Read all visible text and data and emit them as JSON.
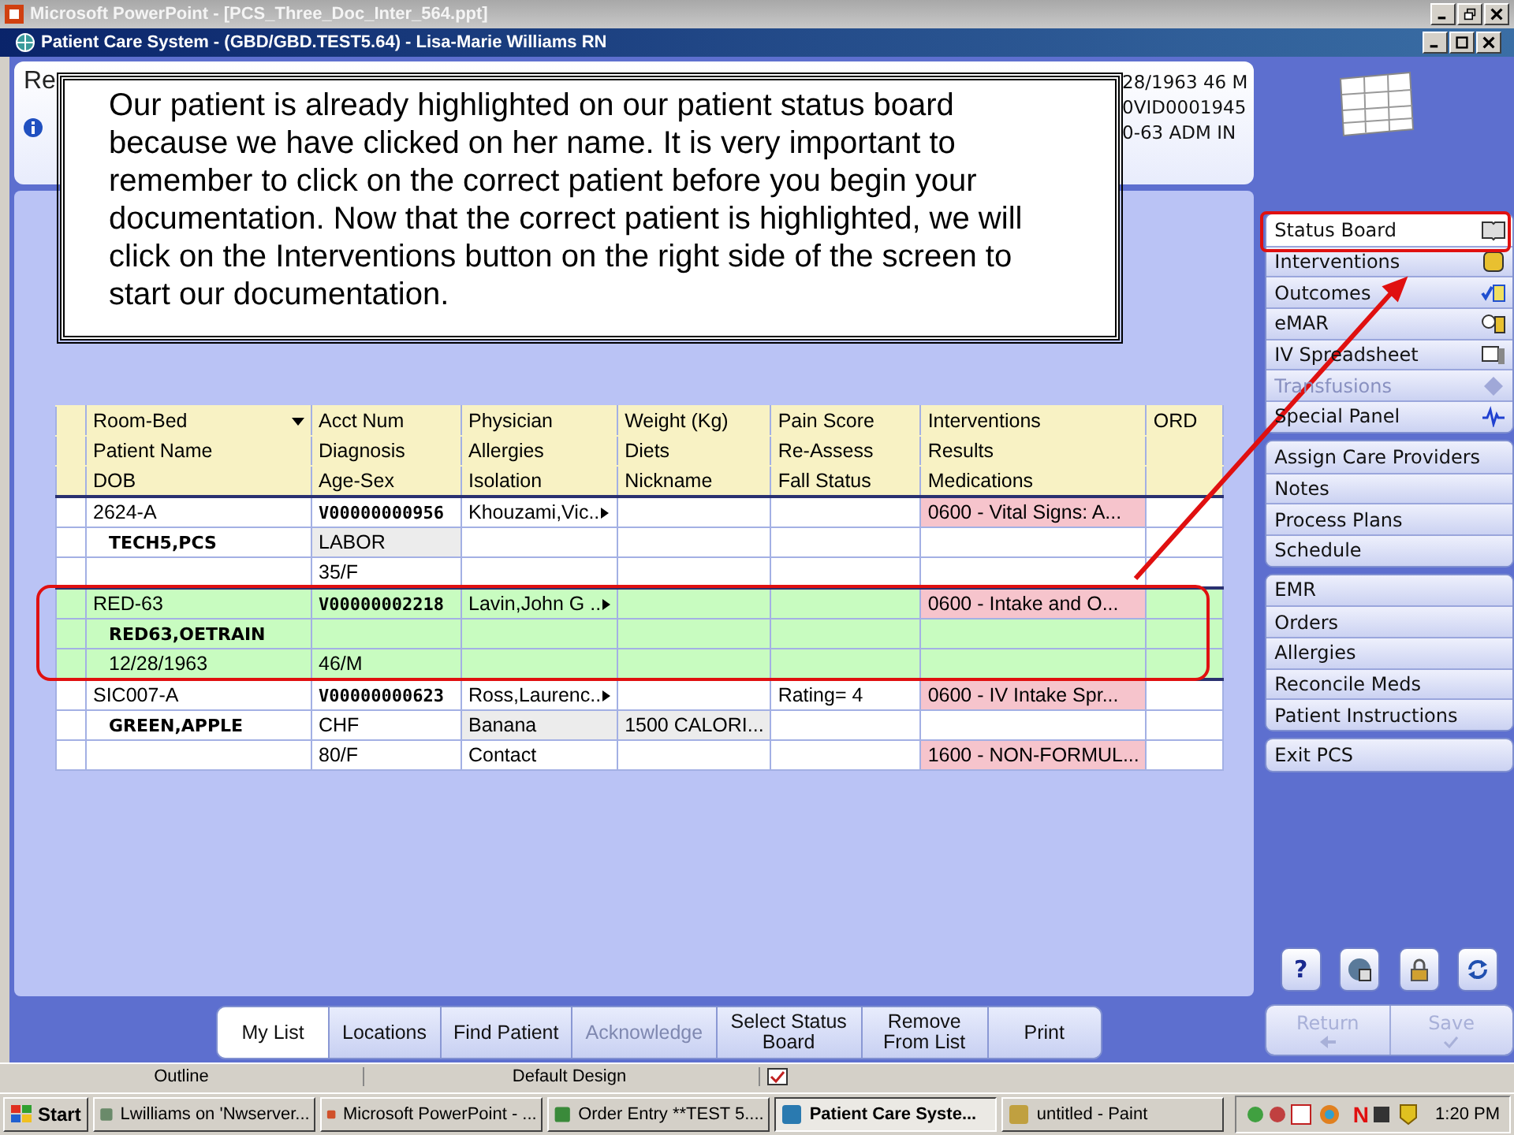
{
  "app_window": {
    "title": "Microsoft PowerPoint - [PCS_Three_Doc_Inter_564.ppt]"
  },
  "pcs_window": {
    "title": "Patient Care System - (GBD/GBD.TEST5.64) - Lisa-Marie Williams RN"
  },
  "patient_header": {
    "name_fragment": "Re",
    "right_lines": [
      "28/1963 46 M",
      "0VID0001945",
      "0-63  ADM IN"
    ]
  },
  "callout": {
    "text": "Our patient is already highlighted on our patient status board because we have clicked on her name. It is very important to remember to click on the correct patient before you begin your documentation. Now that the correct patient is highlighted, we will click on the Interventions button on the right side of the screen to start our documentation."
  },
  "table": {
    "header_rows": [
      [
        {
          "kind": "label",
          "text": "Room-Bed"
        },
        {
          "kind": "label",
          "text": "Acct Num"
        },
        {
          "kind": "label",
          "text": "Physician"
        },
        {
          "kind": "label",
          "text": "Weight (Kg)"
        },
        {
          "kind": "label",
          "text": "Pain Score"
        },
        {
          "kind": "label",
          "text": "Interventions"
        },
        {
          "kind": "label",
          "text": "ORD"
        }
      ],
      [
        {
          "kind": "label",
          "text": "Patient Name"
        },
        {
          "kind": "label",
          "text": "Diagnosis"
        },
        {
          "kind": "label",
          "text": "Allergies"
        },
        {
          "kind": "label",
          "text": "Diets"
        },
        {
          "kind": "label",
          "text": "Re-Assess"
        },
        {
          "kind": "label",
          "text": "Results"
        },
        {
          "kind": "empty"
        }
      ],
      [
        {
          "kind": "label",
          "text": "DOB"
        },
        {
          "kind": "label",
          "text": "Age-Sex"
        },
        {
          "kind": "label",
          "text": "Isolation"
        },
        {
          "kind": "label",
          "text": "Nickname"
        },
        {
          "kind": "label",
          "text": "Fall Status"
        },
        {
          "kind": "label",
          "text": "Medications"
        },
        {
          "kind": "empty"
        }
      ]
    ],
    "patients": [
      {
        "selected": false,
        "lines": [
          [
            {
              "kind": "text",
              "text": "2624-A"
            },
            {
              "kind": "code",
              "text": "V00000000956"
            },
            {
              "kind": "link",
              "text": "Khouzami,Vic.."
            },
            {
              "kind": "empty"
            },
            {
              "kind": "empty"
            },
            {
              "kind": "alert",
              "text": "0600 - Vital Signs: A..."
            },
            {
              "kind": "empty"
            }
          ],
          [
            {
              "kind": "name",
              "text": "TECH5,PCS"
            },
            {
              "kind": "shaded",
              "text": "LABOR"
            },
            {
              "kind": "empty"
            },
            {
              "kind": "empty"
            },
            {
              "kind": "empty"
            },
            {
              "kind": "empty"
            },
            {
              "kind": "empty"
            }
          ],
          [
            {
              "kind": "empty"
            },
            {
              "kind": "text",
              "text": "35/F"
            },
            {
              "kind": "empty"
            },
            {
              "kind": "empty"
            },
            {
              "kind": "empty"
            },
            {
              "kind": "empty"
            },
            {
              "kind": "empty"
            }
          ]
        ]
      },
      {
        "selected": true,
        "lines": [
          [
            {
              "kind": "text",
              "text": "RED-63"
            },
            {
              "kind": "code",
              "text": "V00000002218"
            },
            {
              "kind": "link",
              "text": "Lavin,John G .."
            },
            {
              "kind": "empty"
            },
            {
              "kind": "empty"
            },
            {
              "kind": "alert",
              "text": "0600 - Intake and O..."
            },
            {
              "kind": "empty"
            }
          ],
          [
            {
              "kind": "name",
              "text": "RED63,OETRAIN"
            },
            {
              "kind": "empty"
            },
            {
              "kind": "empty"
            },
            {
              "kind": "empty"
            },
            {
              "kind": "empty"
            },
            {
              "kind": "empty"
            },
            {
              "kind": "empty"
            }
          ],
          [
            {
              "kind": "indent",
              "text": "12/28/1963"
            },
            {
              "kind": "text",
              "text": "46/M"
            },
            {
              "kind": "empty"
            },
            {
              "kind": "empty"
            },
            {
              "kind": "empty"
            },
            {
              "kind": "empty"
            },
            {
              "kind": "empty"
            }
          ]
        ]
      },
      {
        "selected": false,
        "lines": [
          [
            {
              "kind": "text",
              "text": "SIC007-A"
            },
            {
              "kind": "code",
              "text": "V00000000623"
            },
            {
              "kind": "link",
              "text": "Ross,Laurenc.."
            },
            {
              "kind": "empty"
            },
            {
              "kind": "text",
              "text": "Rating= 4"
            },
            {
              "kind": "alert",
              "text": "0600 - IV Intake Spr..."
            },
            {
              "kind": "empty"
            }
          ],
          [
            {
              "kind": "name",
              "text": "GREEN,APPLE"
            },
            {
              "kind": "text",
              "text": "CHF"
            },
            {
              "kind": "shaded",
              "text": "Banana"
            },
            {
              "kind": "shaded",
              "text": "1500 CALORI..."
            },
            {
              "kind": "empty"
            },
            {
              "kind": "empty"
            },
            {
              "kind": "empty"
            }
          ],
          [
            {
              "kind": "empty"
            },
            {
              "kind": "text",
              "text": "80/F"
            },
            {
              "kind": "text",
              "text": "Contact"
            },
            {
              "kind": "empty"
            },
            {
              "kind": "empty"
            },
            {
              "kind": "alert",
              "text": "1600 - NON-FORMUL..."
            },
            {
              "kind": "empty"
            }
          ]
        ]
      }
    ]
  },
  "sidebar": {
    "groups": [
      [
        {
          "label": "Status Board",
          "selected": true,
          "disabled": false
        },
        {
          "label": "Interventions",
          "selected": false,
          "disabled": false
        },
        {
          "label": "Outcomes",
          "selected": false,
          "disabled": false
        },
        {
          "label": "eMAR",
          "selected": false,
          "disabled": false
        },
        {
          "label": "IV Spreadsheet",
          "selected": false,
          "disabled": false
        },
        {
          "label": "Transfusions",
          "selected": false,
          "disabled": true
        },
        {
          "label": "Special Panel",
          "selected": false,
          "disabled": false
        }
      ],
      [
        {
          "label": "Assign Care Providers",
          "selected": false,
          "disabled": false
        },
        {
          "label": "Notes",
          "selected": false,
          "disabled": false
        },
        {
          "label": "Process Plans",
          "selected": false,
          "disabled": false
        },
        {
          "label": "Schedule",
          "selected": false,
          "disabled": false
        }
      ],
      [
        {
          "label": "EMR",
          "selected": false,
          "disabled": false
        },
        {
          "label": "Orders",
          "selected": false,
          "disabled": false
        },
        {
          "label": "Allergies",
          "selected": false,
          "disabled": false
        },
        {
          "label": "Reconcile Meds",
          "selected": false,
          "disabled": false
        },
        {
          "label": "Patient Instructions",
          "selected": false,
          "disabled": false
        }
      ],
      [
        {
          "label": "Exit PCS",
          "selected": false,
          "disabled": false
        }
      ]
    ],
    "help_label": "?",
    "actions": [
      {
        "label": "Return",
        "disabled": true
      },
      {
        "label": "Save",
        "disabled": true
      }
    ]
  },
  "bottom_tabs": [
    {
      "label": "My List",
      "selected": true,
      "disabled": false
    },
    {
      "label": "Locations",
      "selected": false,
      "disabled": false
    },
    {
      "label": "Find Patient",
      "selected": false,
      "disabled": false
    },
    {
      "label": "Acknowledge",
      "selected": false,
      "disabled": true
    },
    {
      "label": "Select Status Board",
      "selected": false,
      "disabled": false
    },
    {
      "label": "Remove From List",
      "selected": false,
      "disabled": false
    },
    {
      "label": "Print",
      "selected": false,
      "disabled": false
    }
  ],
  "status_bar": [
    "Outline",
    "Default Design"
  ],
  "taskbar": {
    "start": "Start",
    "items": [
      {
        "label": "Lwilliams on 'Nwserver...",
        "selected": false
      },
      {
        "label": "Microsoft PowerPoint - ...",
        "selected": false
      },
      {
        "label": "Order Entry **TEST 5....",
        "selected": false
      },
      {
        "label": "Patient Care Syste...",
        "selected": true
      },
      {
        "label": "untitled - Paint",
        "selected": false
      }
    ],
    "tray_letter": "N",
    "clock": "1:20 PM"
  }
}
